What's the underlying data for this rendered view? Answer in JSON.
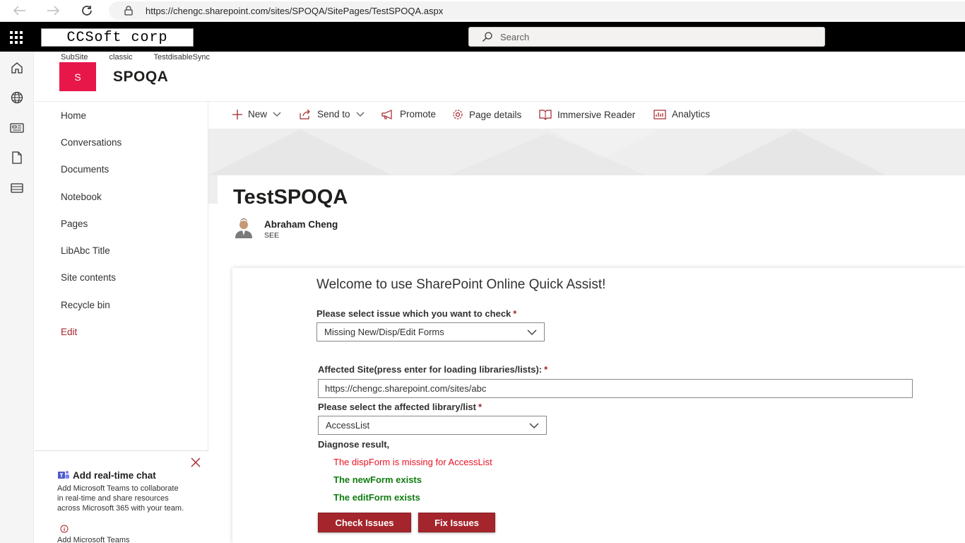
{
  "browser": {
    "url": "https://chengc.sharepoint.com/sites/SPOQA/SitePages/TestSPOQA.aspx",
    "icons": {
      "back": "arrow-left-icon",
      "forward": "arrow-right-icon",
      "refresh": "refresh-icon",
      "secure": "lock-icon"
    }
  },
  "suite": {
    "brand": "CCSoft corp",
    "search_placeholder": "Search"
  },
  "app_bar": {
    "icons": [
      "home-icon",
      "globe-icon",
      "news-icon",
      "file-icon",
      "list-icon"
    ]
  },
  "site": {
    "hub_links": [
      "SubSite",
      "classic",
      "TestdisableSync"
    ],
    "logo_letter": "S",
    "title": "SPOQA",
    "logo_color": "#e8174a"
  },
  "nav": {
    "items": [
      "Home",
      "Conversations",
      "Documents",
      "Notebook",
      "Pages",
      "LibAbc Title",
      "Site contents",
      "Recycle bin"
    ],
    "edit": "Edit"
  },
  "chat": {
    "title": "Add real-time chat",
    "body": "Add Microsoft Teams to collaborate in real-time and share resources across Microsoft 365 with your team.",
    "more": "Add Microsoft Teams"
  },
  "commands": {
    "new": "New",
    "send_to": "Send to",
    "promote": "Promote",
    "page_details": "Page details",
    "immersive_reader": "Immersive Reader",
    "analytics": "Analytics"
  },
  "page": {
    "title": "TestSPOQA",
    "author_name": "Abraham Cheng",
    "author_role": "SEE"
  },
  "quick_assist": {
    "heading": "Welcome to use SharePoint Online Quick Assist!",
    "issue_label": "Please select issue which you want to check",
    "issue_value": "Missing New/Disp/Edit Forms",
    "site_label": "Affected Site(press enter for loading libraries/lists):",
    "site_value": "https://chengc.sharepoint.com/sites/abc",
    "list_label": "Please select the affected library/list",
    "list_value": "AccessList",
    "required_mark": "*",
    "diagnose_label": "Diagnose result,",
    "results": [
      {
        "text": "The dispForm is missing for AccessList",
        "status": "missing"
      },
      {
        "text": "The newForm exists",
        "status": "ok"
      },
      {
        "text": "The editForm exists",
        "status": "ok"
      }
    ],
    "check_button": "Check Issues",
    "fix_button": "Fix Issues",
    "colors": {
      "accent": "#a4262c",
      "missing": "#e81123",
      "ok": "#107c10"
    }
  }
}
